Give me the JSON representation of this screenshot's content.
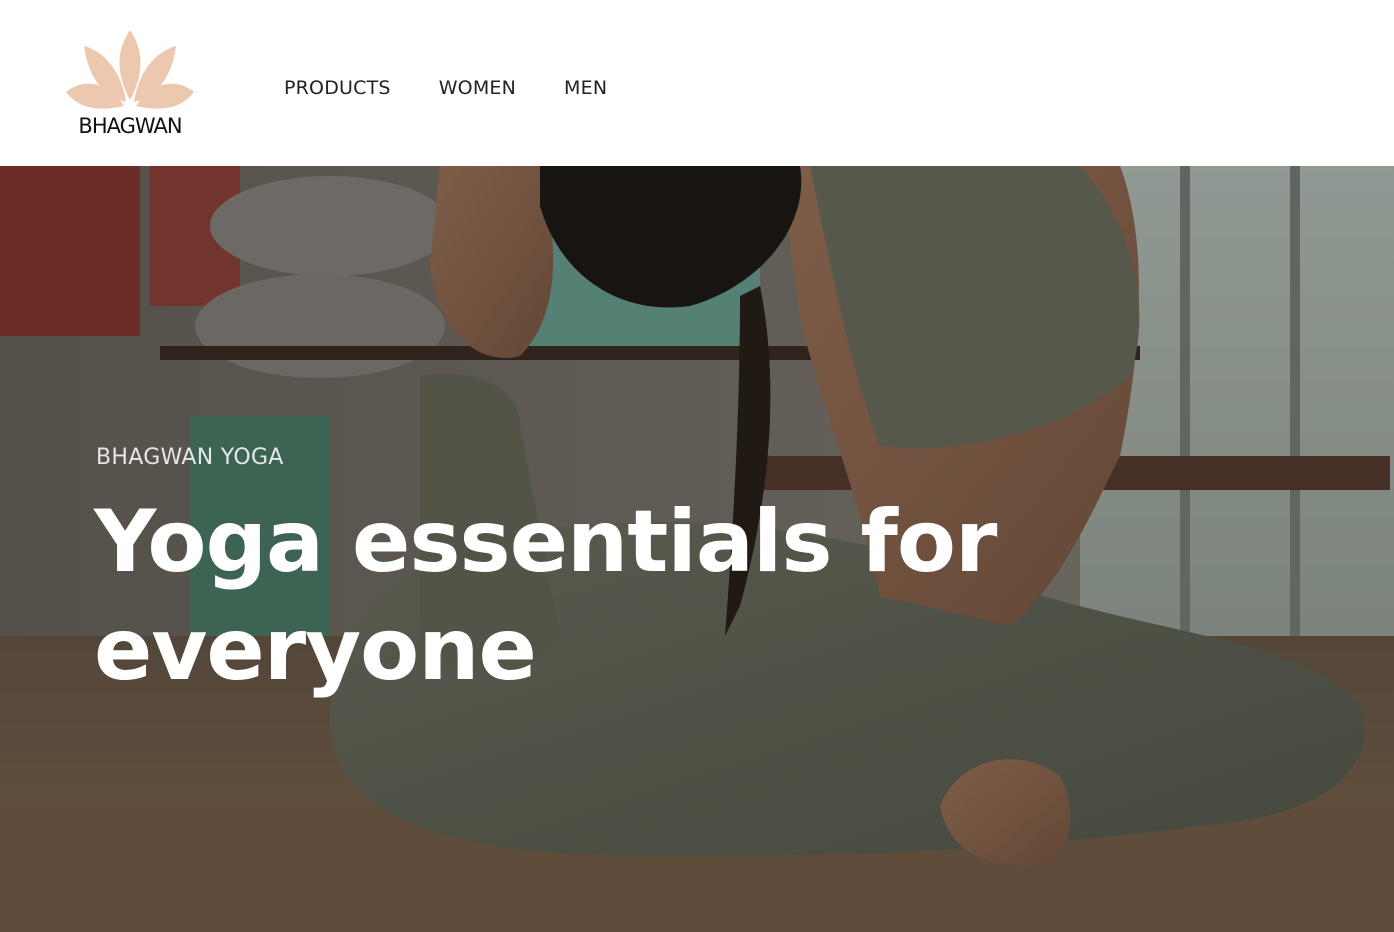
{
  "brand": {
    "name": "BHAGWAN",
    "logo_icon": "lotus-icon",
    "logo_color": "#ecc8ae"
  },
  "nav": {
    "items": [
      {
        "label": "PRODUCTS"
      },
      {
        "label": "WOMEN"
      },
      {
        "label": "MEN"
      }
    ]
  },
  "hero": {
    "eyebrow": "BHAGWAN YOGA",
    "heading": "Yoga essentials for everyone",
    "image_icon": "yoga-pose-photo"
  }
}
